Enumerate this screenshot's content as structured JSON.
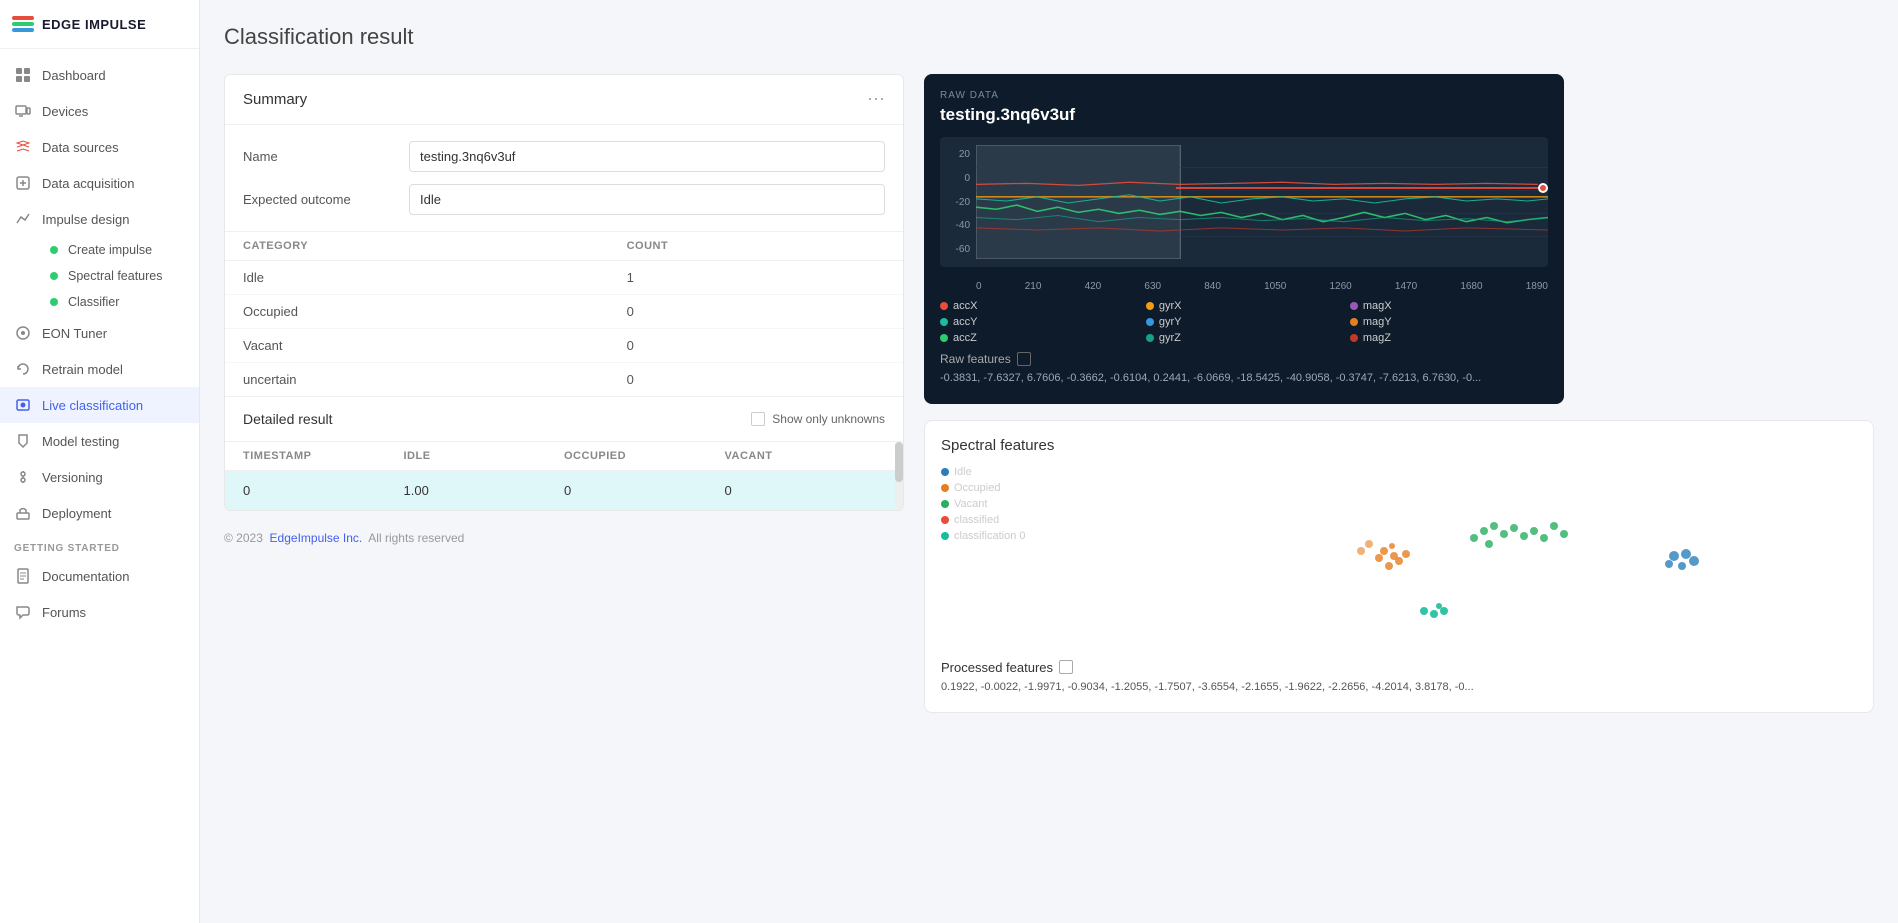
{
  "brand": {
    "name": "EDGE IMPULSE"
  },
  "sidebar": {
    "nav_items": [
      {
        "id": "dashboard",
        "label": "Dashboard",
        "icon": "dashboard-icon",
        "active": false
      },
      {
        "id": "devices",
        "label": "Devices",
        "icon": "devices-icon",
        "active": false
      },
      {
        "id": "data-sources",
        "label": "Data sources",
        "icon": "data-sources-icon",
        "active": false
      },
      {
        "id": "data-acquisition",
        "label": "Data acquisition",
        "icon": "data-acquisition-icon",
        "active": false
      },
      {
        "id": "impulse-design",
        "label": "Impulse design",
        "icon": "impulse-design-icon",
        "active": false
      },
      {
        "id": "create-impulse",
        "label": "Create impulse",
        "dot_color": "#2ecc71"
      },
      {
        "id": "spectral-features",
        "label": "Spectral features",
        "dot_color": "#2ecc71"
      },
      {
        "id": "classifier",
        "label": "Classifier",
        "dot_color": "#2ecc71"
      },
      {
        "id": "eon-tuner",
        "label": "EON Tuner",
        "icon": "eon-tuner-icon",
        "active": false
      },
      {
        "id": "retrain-model",
        "label": "Retrain model",
        "icon": "retrain-icon",
        "active": false
      },
      {
        "id": "live-classification",
        "label": "Live classification",
        "icon": "live-class-icon",
        "active": true
      },
      {
        "id": "model-testing",
        "label": "Model testing",
        "icon": "model-testing-icon",
        "active": false
      },
      {
        "id": "versioning",
        "label": "Versioning",
        "icon": "versioning-icon",
        "active": false
      },
      {
        "id": "deployment",
        "label": "Deployment",
        "icon": "deployment-icon",
        "active": false
      }
    ],
    "getting_started_label": "GETTING STARTED",
    "bottom_items": [
      {
        "id": "documentation",
        "label": "Documentation",
        "icon": "docs-icon"
      },
      {
        "id": "forums",
        "label": "Forums",
        "icon": "forums-icon"
      }
    ]
  },
  "page": {
    "title": "Classification result"
  },
  "summary": {
    "title": "Summary",
    "name_label": "Name",
    "name_value": "testing.3nq6v3uf",
    "expected_outcome_label": "Expected outcome",
    "expected_outcome_value": "Idle",
    "table_headers": [
      "CATEGORY",
      "COUNT"
    ],
    "table_rows": [
      {
        "category": "Idle",
        "count": "1"
      },
      {
        "category": "Occupied",
        "count": "0"
      },
      {
        "category": "Vacant",
        "count": "0"
      },
      {
        "category": "uncertain",
        "count": "0"
      }
    ]
  },
  "detailed_result": {
    "title": "Detailed result",
    "show_unknowns_label": "Show only unknowns",
    "table_headers": [
      "TIMESTAMP",
      "IDLE",
      "OCCUPIED",
      "VACANT"
    ],
    "row": {
      "timestamp": "0",
      "idle": "1.00",
      "occupied": "0",
      "vacant": "0"
    }
  },
  "raw_data": {
    "section_label": "RAW DATA",
    "file_name": "testing.3nq6v3uf",
    "y_labels": [
      "20",
      "0",
      "-20",
      "-40",
      "-60"
    ],
    "x_labels": [
      "0",
      "210",
      "420",
      "630",
      "840",
      "1050",
      "1260",
      "1470",
      "1680",
      "1890"
    ],
    "legend": [
      {
        "label": "accX",
        "color": "#e74c3c"
      },
      {
        "label": "gyrX",
        "color": "#f39c12"
      },
      {
        "label": "magX",
        "color": "#9b59b6"
      },
      {
        "label": "accY",
        "color": "#1abc9c"
      },
      {
        "label": "gyrY",
        "color": "#3498db"
      },
      {
        "label": "magY",
        "color": "#e67e22"
      },
      {
        "label": "accZ",
        "color": "#2ecc71"
      },
      {
        "label": "gyrZ",
        "color": "#16a085"
      },
      {
        "label": "magZ",
        "color": "#c0392b"
      }
    ],
    "raw_features_label": "Raw features",
    "raw_features_values": "-0.3831, -7.6327, 6.7606, -0.3662, -0.6104, 0.2441, -6.0669, -18.5425, -40.9058, -0.3747, -7.6213, 6.7630, -0..."
  },
  "spectral": {
    "title": "Spectral features",
    "legend_items": [
      {
        "label": "Idle",
        "color": "#2980b9"
      },
      {
        "label": "Occupied",
        "color": "#e67e22"
      },
      {
        "label": "Vacant",
        "color": "#27ae60"
      },
      {
        "label": "classified",
        "color": "#e74c3c"
      },
      {
        "label": "classification 0",
        "color": "#1abc9c"
      }
    ],
    "processed_features_label": "Processed features",
    "processed_values": "0.1922, -0.0022, -1.9971, -0.9034, -1.2055, -1.7507, -3.6554, -2.1655, -1.9622, -2.2656, -4.2014, 3.8178, -0..."
  },
  "footer": {
    "copyright": "© 2023",
    "link_text": "EdgeImpulse Inc.",
    "rest": "All rights reserved"
  }
}
